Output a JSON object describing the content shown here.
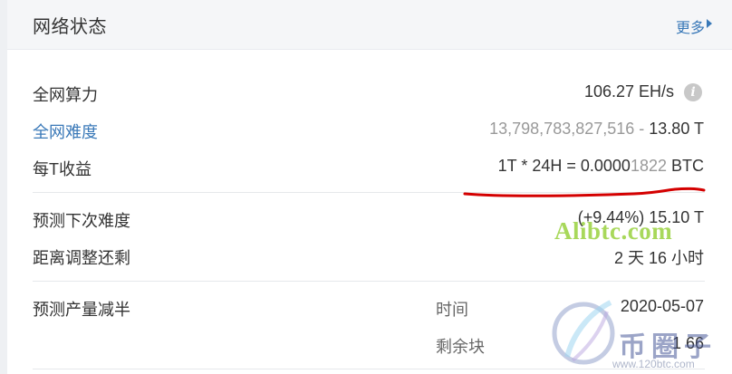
{
  "header": {
    "title": "网络状态",
    "more_label": "更多"
  },
  "rows": {
    "hashrate": {
      "label": "全网算力",
      "value": "106.27 EH/s",
      "info_icon": "info-icon"
    },
    "difficulty": {
      "label": "全网难度",
      "value_main": "13,798,783,827,516",
      "value_sep": " - ",
      "value_short": "13.80 T"
    },
    "earnings": {
      "label": "每T收益",
      "value_prefix": "1T * 24H = 0.0000",
      "value_highlight": "1822",
      "value_suffix": " BTC"
    },
    "next_difficulty": {
      "label": "预测下次难度",
      "value": "(+9.44%) 15.10 T"
    },
    "adjust_remaining": {
      "label": "距离调整还剩",
      "value": "2 天 16 小时"
    },
    "halving": {
      "label": "预测产量减半",
      "time_key": "时间",
      "time_value": "2020-05-07",
      "blocks_key": "剩余块",
      "blocks_value": "1 66"
    }
  },
  "annotation": {
    "underline_color": "#d40000"
  },
  "watermark": {
    "text": "Alibtc.com",
    "brand": "币圈子",
    "site": "www.120btc.com",
    "text_color": "#9ad23f"
  }
}
